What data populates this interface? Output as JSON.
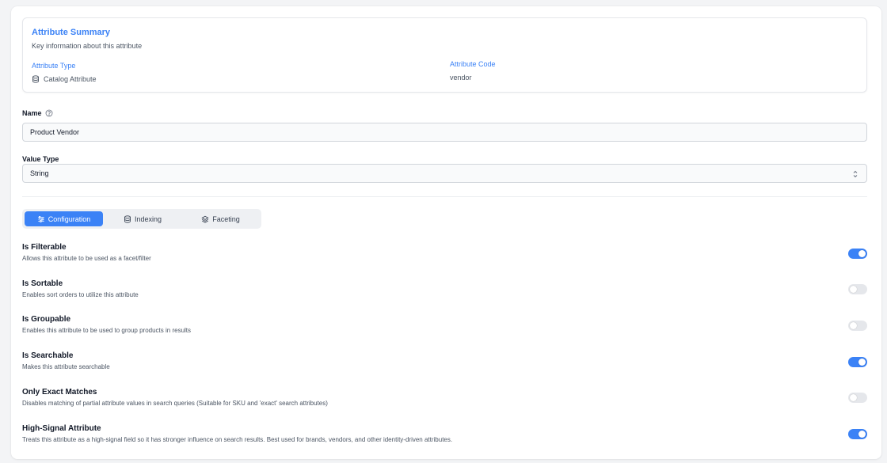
{
  "summary": {
    "title": "Attribute Summary",
    "subtitle": "Key information about this attribute",
    "type_label": "Attribute Type",
    "type_value": "Catalog Attribute",
    "type_icon": "database-icon",
    "code_label": "Attribute Code",
    "code_value": "vendor"
  },
  "name_field": {
    "label": "Name",
    "value": "Product Vendor",
    "help_icon": "help-circle-icon"
  },
  "value_type": {
    "label": "Value Type",
    "selected": "String"
  },
  "tabs": [
    {
      "label": "Configuration",
      "icon": "sliders-icon",
      "active": true
    },
    {
      "label": "Indexing",
      "icon": "database-icon",
      "active": false
    },
    {
      "label": "Faceting",
      "icon": "layers-icon",
      "active": false
    }
  ],
  "options": [
    {
      "title": "Is Filterable",
      "description": "Allows this attribute to be used as a facet/filter",
      "enabled": true
    },
    {
      "title": "Is Sortable",
      "description": "Enables sort orders to utilize this attribute",
      "enabled": false
    },
    {
      "title": "Is Groupable",
      "description": "Enables this attribute to be used to group products in results",
      "enabled": false
    },
    {
      "title": "Is Searchable",
      "description": "Makes this attribute searchable",
      "enabled": true
    },
    {
      "title": "Only Exact Matches",
      "description": "Disables matching of partial attribute values in search queries (Suitable for SKU and 'exact' search attributes)",
      "enabled": false
    },
    {
      "title": "High-Signal Attribute",
      "description": "Treats this attribute as a high-signal field so it has stronger influence on search results. Best used for brands, vendors, and other identity-driven attributes.",
      "enabled": true
    }
  ],
  "colors": {
    "accent": "#3b82f6",
    "toggle_off": "#e5e7eb",
    "text_muted": "#4b5563"
  }
}
